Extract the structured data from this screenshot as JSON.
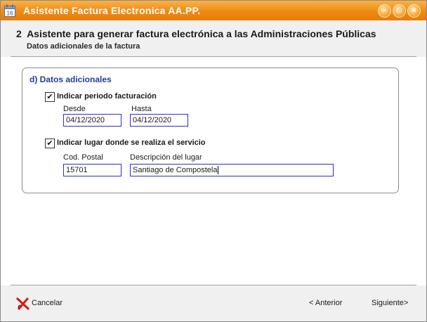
{
  "window": {
    "title": "Asistente Factura Electronica AA.PP."
  },
  "header": {
    "step_number": "2",
    "title": "Asistente para generar factura electrónica a las Administraciones Públicas",
    "subtitle": "Datos adicionales de la factura"
  },
  "group": {
    "title": "d) Datos adicionales",
    "periodo": {
      "checkbox_label": "Indicar periodo facturación",
      "checked": true,
      "desde_label": "Desde",
      "desde_value": "04/12/2020",
      "hasta_label": "Hasta",
      "hasta_value": "04/12/2020"
    },
    "lugar": {
      "checkbox_label": "Indicar lugar donde se realiza el servicio",
      "checked": true,
      "cp_label": "Cod. Postal",
      "cp_value": "15701",
      "desc_label": "Descripción del lugar",
      "desc_value": "Santiago de Compostela"
    }
  },
  "footer": {
    "cancel_label": "Cancelar",
    "prev_label": "< Anterior",
    "next_label": "Siguiente>"
  },
  "colors": {
    "titlebar": "#ef8a12",
    "field_border": "#2b2bdc",
    "group_title": "#1f3f9a"
  },
  "icons": [
    "calendar-app-icon",
    "minimize-icon",
    "maximize-icon",
    "close-icon",
    "cancel-x-icon",
    "check-icon"
  ]
}
